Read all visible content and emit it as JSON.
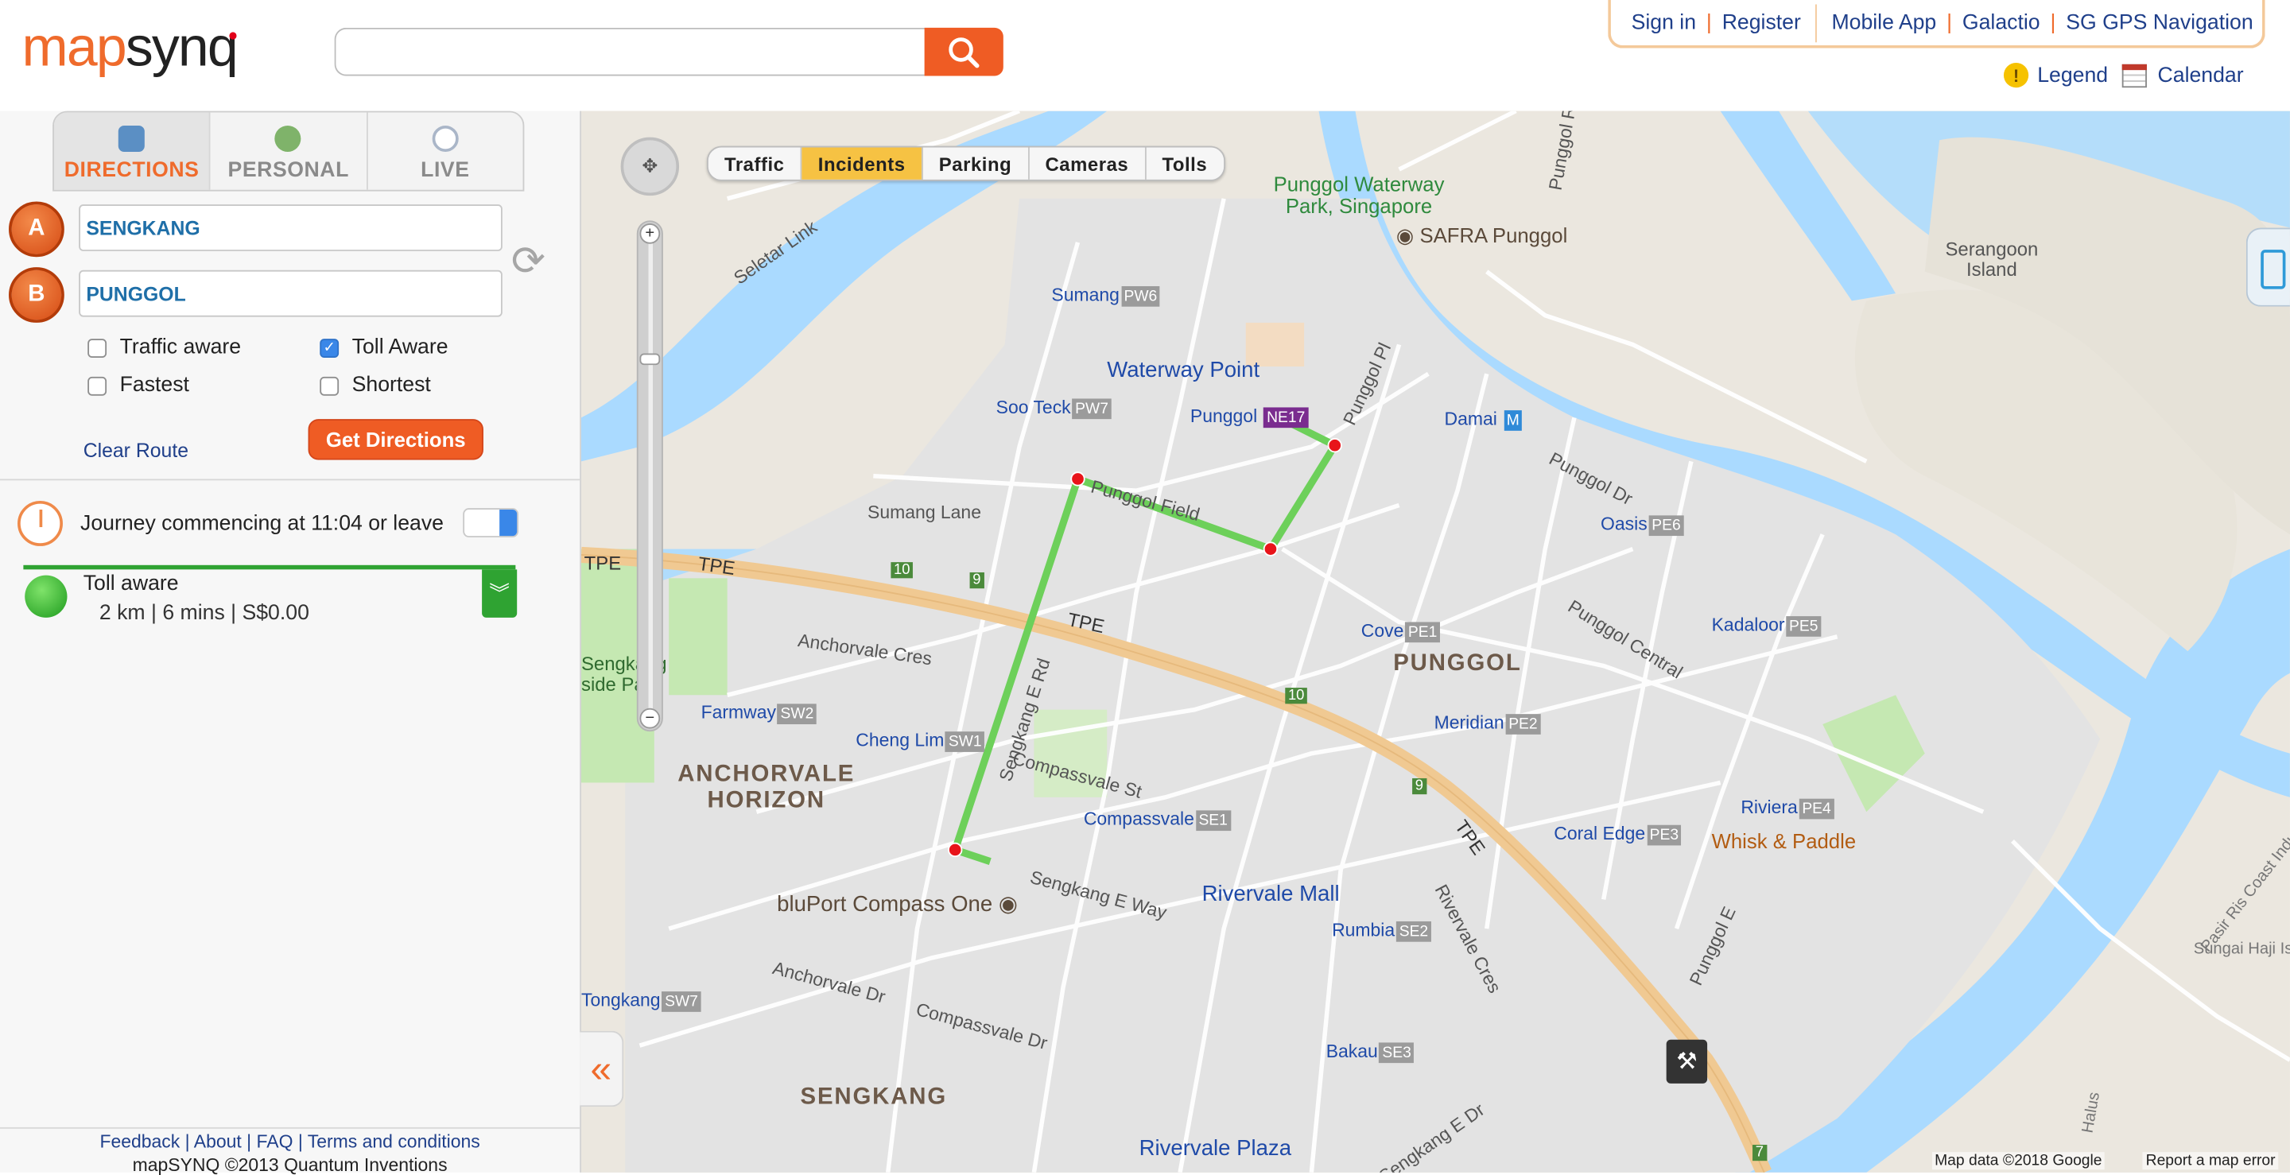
{
  "header": {
    "logo_part1": "map",
    "logo_part2": "synq",
    "search_placeholder": "",
    "search_icon": "search-icon",
    "links": {
      "sign_in": "Sign in",
      "register": "Register",
      "mobile_app": "Mobile App",
      "galactio": "Galactio",
      "sg_gps": "SG GPS Navigation"
    },
    "legend_label": "Legend",
    "legend_icon_glyph": "!",
    "calendar_label": "Calendar"
  },
  "panel": {
    "tabs": [
      {
        "label": "DIRECTIONS",
        "icon": "car-icon"
      },
      {
        "label": "PERSONAL",
        "icon": "person-icon"
      },
      {
        "label": "LIVE",
        "icon": "clock-icon"
      }
    ],
    "pin_a": "A",
    "pin_b": "B",
    "origin_value": "SENGKANG",
    "destination_value": "PUNGGOL",
    "options": {
      "traffic_aware": {
        "label": "Traffic aware",
        "checked": false
      },
      "toll_aware": {
        "label": "Toll Aware",
        "checked": true
      },
      "fastest": {
        "label": "Fastest",
        "checked": false
      },
      "shortest": {
        "label": "Shortest",
        "checked": false
      }
    },
    "clear_route": "Clear Route",
    "get_directions": "Get Directions",
    "journey_text": "Journey commencing at 11:04 or leave",
    "route": {
      "title": "Toll aware",
      "info": "2 km | 6 mins | S$0.00"
    }
  },
  "footer": {
    "feedback": "Feedback",
    "about": "About",
    "faq": "FAQ",
    "terms": "Terms and conditions",
    "copyright": "mapSYNQ ©2013 Quantum Inventions"
  },
  "map": {
    "overlay_tabs": [
      "Traffic",
      "Incidents",
      "Parking",
      "Cameras",
      "Tolls"
    ],
    "active_overlay": "Incidents",
    "attribution": "Map data ©2018 Google",
    "report": "Report a map error",
    "labels": {
      "punggol_waterway": "Punggol Waterway\nPark, Singapore",
      "safra": "SAFRA Punggol",
      "serangoon_island": "Serangoon\nIsland",
      "seletar_link": "Seletar Link",
      "punggol_rd": "Punggol Rd",
      "sumang": "Sumang",
      "pw6": "PW6",
      "waterway_point": "Waterway Point",
      "soo_teck": "Soo Teck",
      "pw7": "PW7",
      "punggol_stn": "Punggol",
      "ne17": "NE17",
      "punggol_pl": "Punggol Pl",
      "damai": "Damai",
      "punggol_dr": "Punggol Dr",
      "sumang_lane": "Sumang Lane",
      "punggol_field": "Punggol Field",
      "oasis": "Oasis",
      "pe6": "PE6",
      "tpe": "TPE",
      "ten": "10",
      "nine": "9",
      "anchorvale_cres": "Anchorvale Cres",
      "cove": "Cove",
      "pe1": "PE1",
      "punggol_area": "PUNGGOL",
      "kadaloor": "Kadaloor",
      "pe5": "PE5",
      "punggol_central": "Punggol Central",
      "sengkang_park": "Sengkang\nside Pa",
      "farmway": "Farmway",
      "sw2": "SW2",
      "meridian": "Meridian",
      "pe2": "PE2",
      "cheng_lim": "Cheng Lim",
      "sw1": "SW1",
      "sengkang_e_rd": "Sengkang E Rd",
      "compassvale_st": "Compassvale St",
      "anchorvale_horizon": "ANCHORVALE\nHORIZON",
      "compassvale": "Compassvale",
      "se1": "SE1",
      "coral_edge": "Coral Edge",
      "pe3": "PE3",
      "riviera": "Riviera",
      "pe4": "PE4",
      "whisk": "Whisk & Paddle",
      "bluport": "bluPort Compass One",
      "sengkang_e_way": "Sengkang E Way",
      "rivervale_mall": "Rivervale Mall",
      "rumbia": "Rumbia",
      "se2": "SE2",
      "rivervale_cres": "Rivervale Cres",
      "pasir_ris": "Pasir Ris Coast Industrial",
      "anchorvale_dr": "Anchorvale Dr",
      "compassvale_dr": "Compassvale Dr",
      "tongkang": "Tongkang",
      "sw7": "SW7",
      "bakau": "Bakau",
      "se3": "SE3",
      "punggol_e": "Punggol E",
      "sengkang_area": "SENGKANG",
      "rivervale_plaza": "Rivervale Plaza",
      "sengkang_e_dr": "Sengkang E Dr",
      "halus": "Halus",
      "sungai": "Sungai Haji Ism",
      "seven": "7"
    }
  }
}
